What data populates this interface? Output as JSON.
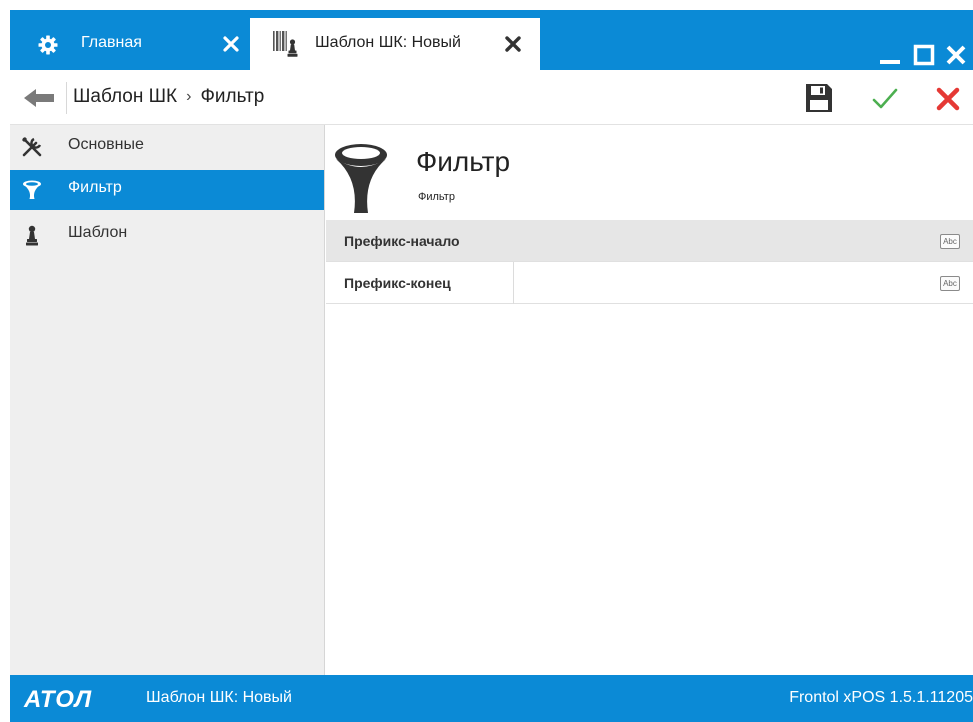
{
  "tabs": [
    {
      "label": "Главная",
      "icon": "gear-icon",
      "active": false
    },
    {
      "label": "Шаблон ШК: Новый",
      "icon": "barcode-template-icon",
      "active": true
    }
  ],
  "window_controls": {
    "minimize_icon": "minimize-icon",
    "maximize_icon": "maximize-icon",
    "close_icon": "close-icon"
  },
  "toolbar": {
    "breadcrumb": {
      "root": "Шаблон ШК",
      "separator": "›",
      "current": "Фильтр"
    },
    "save_icon": "save-icon",
    "ok_icon": "checkmark-icon",
    "cancel_icon": "cancel-icon"
  },
  "sidebar": {
    "items": [
      {
        "label": "Основные",
        "icon": "tools-icon",
        "active": false
      },
      {
        "label": "Фильтр",
        "icon": "filter-icon",
        "active": true
      },
      {
        "label": "Шаблон",
        "icon": "pawn-icon",
        "active": false
      }
    ]
  },
  "content": {
    "title": "Фильтр",
    "subtitle": "Фильтр",
    "properties": [
      {
        "label": "Префикс-начало",
        "value": "",
        "type_badge": "Abc",
        "highlighted": true
      },
      {
        "label": "Префикс-конец",
        "value": "",
        "type_badge": "Abc",
        "highlighted": false
      }
    ]
  },
  "statusbar": {
    "logo": "АТОЛ",
    "document": "Шаблон ШК: Новый",
    "version": "Frontol xPOS 1.5.1.11205"
  },
  "colors": {
    "accent": "#0b8ad6",
    "ok": "#4caf50",
    "cancel": "#e53935",
    "sidebar_bg": "#efefef"
  }
}
